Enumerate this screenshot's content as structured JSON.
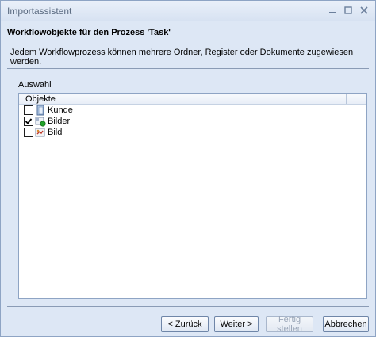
{
  "window": {
    "title": "Importassistent"
  },
  "header": {
    "title": "Workflowobjekte für den Prozess 'Task'",
    "description": "Jedem Workflowprozess können mehrere Ordner, Register oder Dokumente zugewiesen werden."
  },
  "group": {
    "label": "Auswahl"
  },
  "list": {
    "column": "Objekte",
    "items": [
      {
        "label": "Kunde",
        "checked": false,
        "icon": "folder-icon"
      },
      {
        "label": "Bilder",
        "checked": true,
        "icon": "register-icon"
      },
      {
        "label": "Bild",
        "checked": false,
        "icon": "document-icon"
      }
    ]
  },
  "buttons": {
    "back": "< Zurück",
    "next": "Weiter >",
    "finish": "Fertig stellen",
    "cancel": "Abbrechen"
  }
}
